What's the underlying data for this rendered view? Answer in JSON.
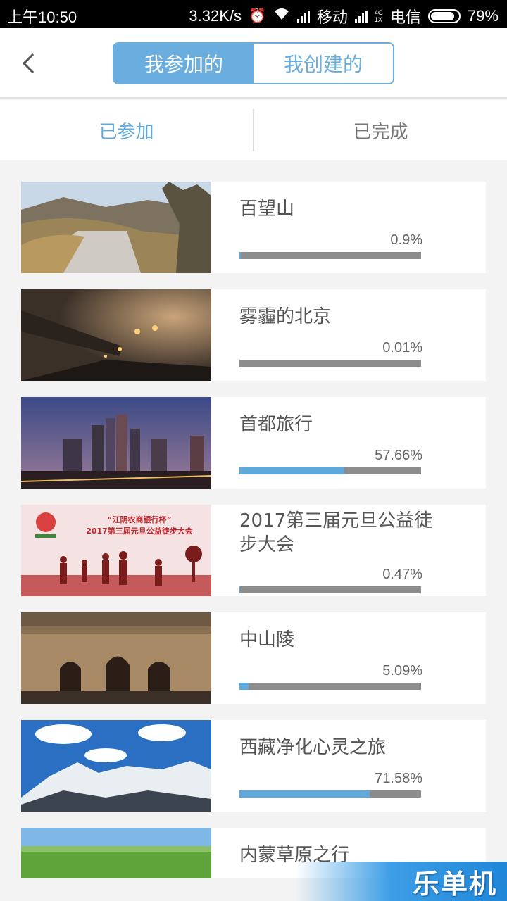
{
  "status_bar": {
    "time": "上午10:50",
    "net_speed": "3.32K/s",
    "carrier1": "移动",
    "net_type_top": "4G",
    "net_type_bottom": "1X",
    "carrier2": "电信",
    "battery": "79%"
  },
  "header": {
    "tabs": [
      {
        "label": "我参加的",
        "active": true
      },
      {
        "label": "我创建的",
        "active": false
      }
    ]
  },
  "subtabs": [
    {
      "label": "已参加",
      "active": true
    },
    {
      "label": "已完成",
      "active": false
    }
  ],
  "activities": [
    {
      "title": "百望山",
      "percent_label": "0.9%",
      "progress": 0.009
    },
    {
      "title": "雾霾的北京",
      "percent_label": "0.01%",
      "progress": 0.0001
    },
    {
      "title": "首都旅行",
      "percent_label": "57.66%",
      "progress": 0.5766
    },
    {
      "title": "2017第三届元旦公益徒步大会",
      "percent_label": "0.47%",
      "progress": 0.0047
    },
    {
      "title": "中山陵",
      "percent_label": "5.09%",
      "progress": 0.0509
    },
    {
      "title": "西藏净化心灵之旅",
      "percent_label": "71.58%",
      "progress": 0.7158
    },
    {
      "title": "内蒙草原之行",
      "percent_label": "",
      "progress": null
    }
  ],
  "banner_text": {
    "line1": "“江阴农商银行杯”",
    "line2": "2017第三届元旦公益徒步大会"
  },
  "watermark": "乐单机",
  "colors": {
    "accent": "#5ea8dc",
    "bar_track": "#8c8c8c"
  }
}
